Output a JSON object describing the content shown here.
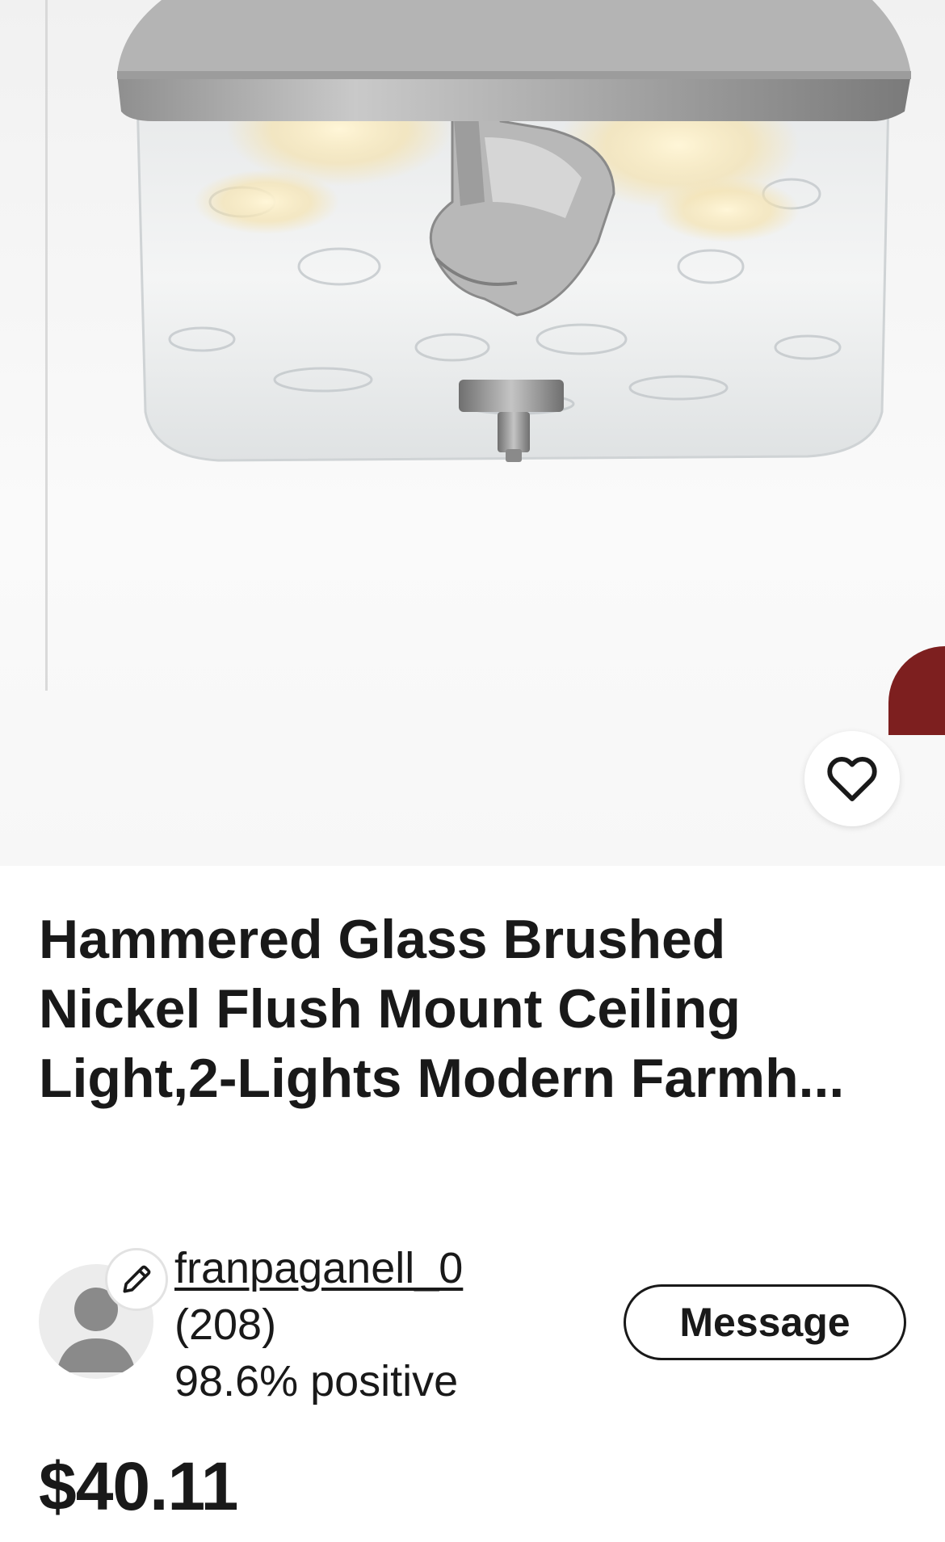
{
  "listing": {
    "title": "Hammered Glass Brushed Nickel Flush Mount Ceiling Light,2-Lights Modern Farmh...",
    "price": "$40.11"
  },
  "hero": {
    "image_subject": "flush-mount-ceiling-light-photo",
    "accent_peek_color": "#7d1f1f"
  },
  "watch": {
    "icon": "heart-icon"
  },
  "seller": {
    "username": "franpaganell_0",
    "feedback_count": "(208)",
    "feedback_percent": "98.6% positive",
    "avatar_icon": "person-icon",
    "edit_icon": "pencil-icon"
  },
  "actions": {
    "message_label": "Message"
  }
}
